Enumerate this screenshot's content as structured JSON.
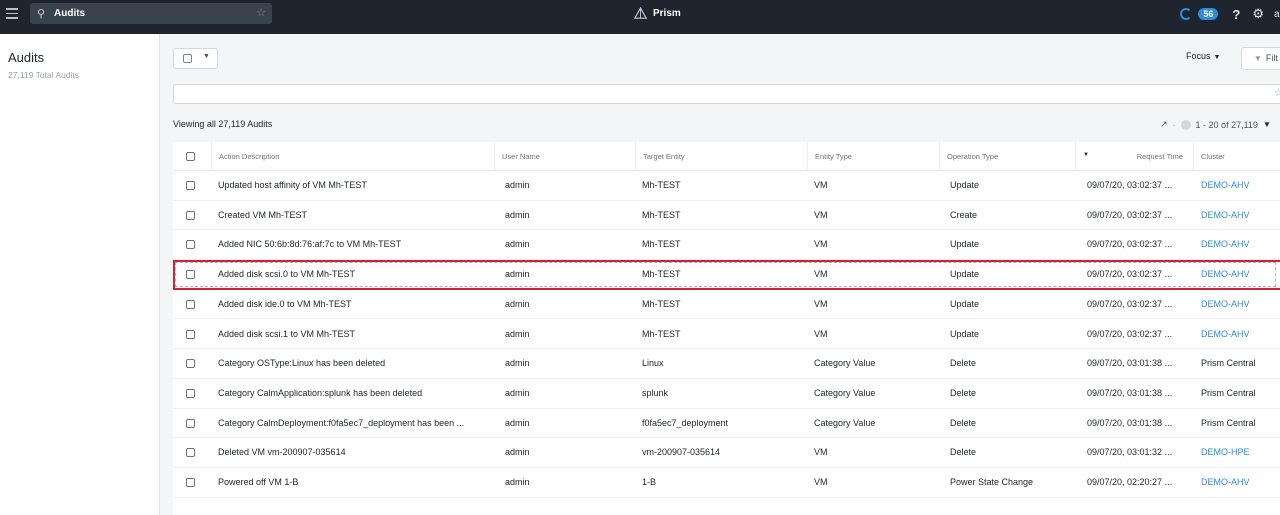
{
  "topbar": {
    "search_value": "Audits",
    "brand": "Prism",
    "alert_count": "56",
    "help": "?",
    "user_initial": "a"
  },
  "leftpanel": {
    "title": "Audits",
    "subtitle": "27,119 Total Audits"
  },
  "toolbar": {
    "focus_label": "Focus",
    "filter_label": "Filt",
    "viewing_label": "Viewing all 27,119 Audits",
    "pager_text": "1 - 20 of 27,119"
  },
  "table": {
    "headers": [
      "Action Description",
      "User Name",
      "Target Entity",
      "Entity Type",
      "Operation Type",
      "Request Time",
      "Cluster"
    ],
    "rows": [
      [
        "Updated host affinity of VM Mh-TEST",
        "admin",
        "Mh-TEST",
        "VM",
        "Update",
        "09/07/20, 03:02:37 ...",
        "DEMO-AHV"
      ],
      [
        "Created VM Mh-TEST",
        "admin",
        "Mh-TEST",
        "VM",
        "Create",
        "09/07/20, 03:02:37 ...",
        "DEMO-AHV"
      ],
      [
        "Added NIC 50:6b:8d:76:af:7c to VM Mh-TEST",
        "admin",
        "Mh-TEST",
        "VM",
        "Update",
        "09/07/20, 03:02:37 ...",
        "DEMO-AHV"
      ],
      [
        "Added disk scsi.0 to VM Mh-TEST",
        "admin",
        "Mh-TEST",
        "VM",
        "Update",
        "09/07/20, 03:02:37 ...",
        "DEMO-AHV"
      ],
      [
        "Added disk ide.0 to VM Mh-TEST",
        "admin",
        "Mh-TEST",
        "VM",
        "Update",
        "09/07/20, 03:02:37 ...",
        "DEMO-AHV"
      ],
      [
        "Added disk scsi.1 to VM Mh-TEST",
        "admin",
        "Mh-TEST",
        "VM",
        "Update",
        "09/07/20, 03:02:37 ...",
        "DEMO-AHV"
      ],
      [
        "Category OSType:Linux has been deleted",
        "admin",
        "Linux",
        "Category Value",
        "Delete",
        "09/07/20, 03:01:38 ...",
        "Prism Central"
      ],
      [
        "Category CalmApplication:splunk has been deleted",
        "admin",
        "splunk",
        "Category Value",
        "Delete",
        "09/07/20, 03:01:38 ...",
        "Prism Central"
      ],
      [
        "Category CalmDeployment:f0fa5ec7_deployment has been ...",
        "admin",
        "f0fa5ec7_deployment",
        "Category Value",
        "Delete",
        "09/07/20, 03:01:38 ...",
        "Prism Central"
      ],
      [
        "Deleted VM vm-200907-035614",
        "admin",
        "vm-200907-035614",
        "VM",
        "Delete",
        "09/07/20, 03:01:32 ...",
        "DEMO-HPE"
      ],
      [
        "Powered off VM 1-B",
        "admin",
        "1-B",
        "VM",
        "Power State Change",
        "09/07/20, 02:20:27 ...",
        "DEMO-AHV"
      ]
    ],
    "highlighted_row": 3
  },
  "colors": {
    "topbar_bg": "#1f252e",
    "accent": "#2f8cd6",
    "highlight": "#c8243a"
  },
  "icons": [
    "hamburger-icon",
    "search-icon",
    "star-icon",
    "prism-logo-icon",
    "task-spinner-icon",
    "help-icon",
    "gear-icon",
    "chevron-down-icon",
    "filter-icon",
    "external-link-icon",
    "prev-page-icon"
  ]
}
